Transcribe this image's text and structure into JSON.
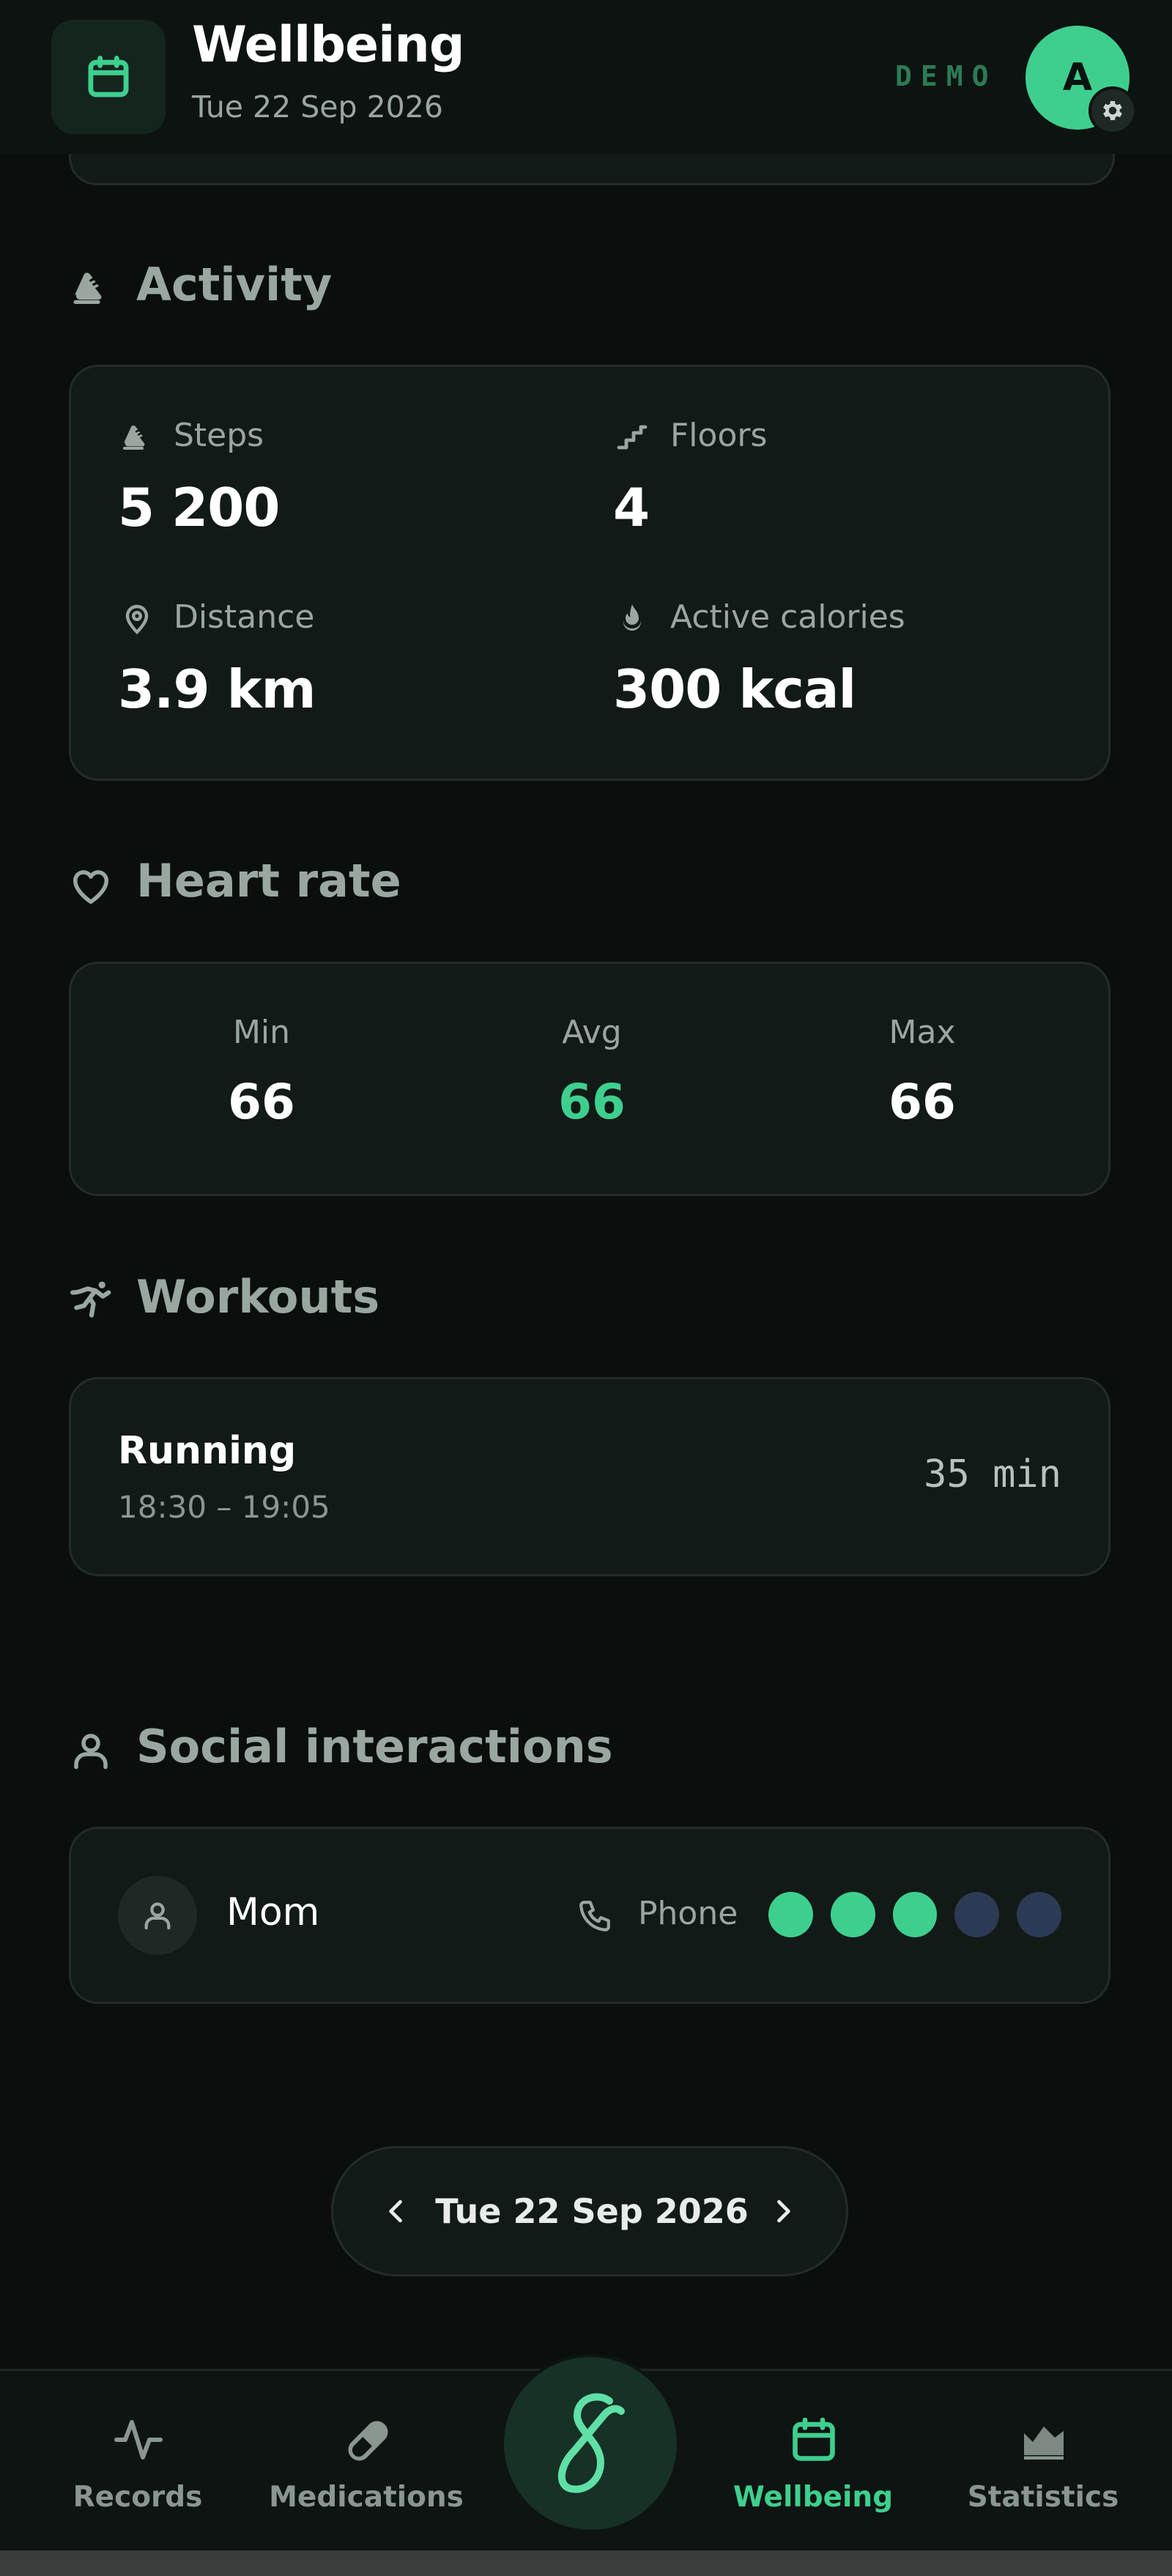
{
  "header": {
    "title": "Wellbeing",
    "date": "Tue 22 Sep 2026",
    "mode_badge": "DEMO",
    "avatar_initial": "A",
    "icon": "calendar-icon"
  },
  "sections": {
    "activity": {
      "title": "Activity",
      "icon": "shoe-icon",
      "stats": {
        "steps": {
          "label": "Steps",
          "value": "5 200",
          "icon": "shoe-icon"
        },
        "floors": {
          "label": "Floors",
          "value": "4",
          "icon": "stairs-icon"
        },
        "distance": {
          "label": "Distance",
          "value": "3.9 km",
          "icon": "location-pin-icon"
        },
        "calories": {
          "label": "Active calories",
          "value": "300 kcal",
          "icon": "flame-icon"
        }
      }
    },
    "heart_rate": {
      "title": "Heart rate",
      "icon": "heart-icon",
      "min": {
        "label": "Min",
        "value": "66"
      },
      "avg": {
        "label": "Avg",
        "value": "66"
      },
      "max": {
        "label": "Max",
        "value": "66"
      }
    },
    "workouts": {
      "title": "Workouts",
      "icon": "running-figure-icon",
      "items": [
        {
          "name": "Running",
          "time": "18:30 – 19:05",
          "duration": "35 min"
        }
      ]
    },
    "social": {
      "title": "Social interactions",
      "icon": "person-icon",
      "items": [
        {
          "name": "Mom",
          "channel": "Phone",
          "rating": 3,
          "rating_max": 5
        }
      ]
    }
  },
  "date_nav": {
    "label": "Tue 22 Sep 2026"
  },
  "bottom_nav": {
    "items": [
      {
        "label": "Records",
        "icon": "pulse-icon",
        "active": false
      },
      {
        "label": "Medications",
        "icon": "pill-icon",
        "active": false
      },
      {
        "label": "Wellbeing",
        "icon": "calendar-icon",
        "active": true
      },
      {
        "label": "Statistics",
        "icon": "chart-area-icon",
        "active": false
      }
    ],
    "center_icon": "app-logo-icon"
  },
  "colors": {
    "accent": "#3ecf8e",
    "background": "#0a0f0d",
    "card": "#121a17",
    "muted_text": "#9aa7a1",
    "dot_filled": "#3ecf8e",
    "dot_empty": "#2c3a55"
  }
}
